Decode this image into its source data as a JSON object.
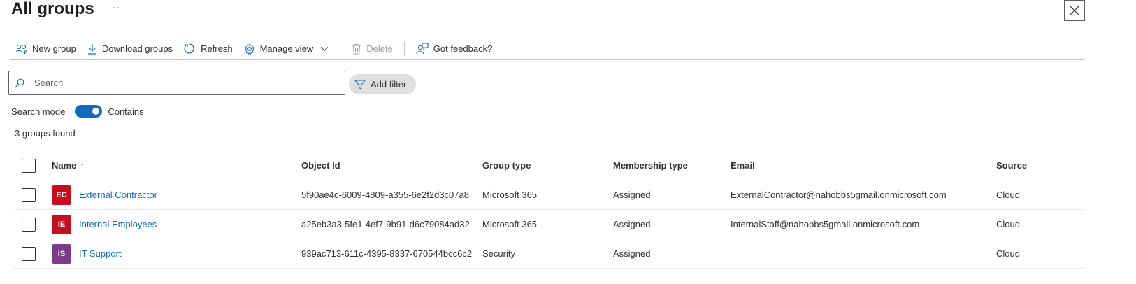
{
  "page": {
    "title": "All groups",
    "more_label": "···"
  },
  "toolbar": {
    "new_group": "New group",
    "download_groups": "Download groups",
    "refresh": "Refresh",
    "manage_view": "Manage view",
    "delete": "Delete",
    "feedback": "Got feedback?"
  },
  "search": {
    "placeholder": "Search",
    "value": ""
  },
  "filter": {
    "add_filter": "Add filter"
  },
  "search_mode": {
    "label": "Search mode",
    "value": "Contains",
    "enabled": true
  },
  "results": {
    "count_text": "3 groups found"
  },
  "table": {
    "columns": {
      "name": "Name",
      "sort_indicator": "↑",
      "object_id": "Object Id",
      "group_type": "Group type",
      "membership_type": "Membership type",
      "email": "Email",
      "source": "Source"
    },
    "rows": [
      {
        "initials": "EC",
        "avatar_color": "#c50f1f",
        "name": "External Contractor",
        "object_id": "5f90ae4c-6009-4809-a355-6e2f2d3c07a8",
        "group_type": "Microsoft 365",
        "membership_type": "Assigned",
        "email": "ExternalContractor@nahobbs5gmail.onmicrosoft.com",
        "source": "Cloud"
      },
      {
        "initials": "IE",
        "avatar_color": "#c50f1f",
        "name": "Internal Employees",
        "object_id": "a25eb3a3-5fe1-4ef7-9b91-d6c79084ad32",
        "group_type": "Microsoft 365",
        "membership_type": "Assigned",
        "email": "InternalStaff@nahobbs5gmail.onmicrosoft.com",
        "source": "Cloud"
      },
      {
        "initials": "IS",
        "avatar_color": "#7a3b8a",
        "name": "IT Support",
        "object_id": "939ac713-611c-4395-8337-670544bcc6c2",
        "group_type": "Security",
        "membership_type": "Assigned",
        "email": "",
        "source": "Cloud"
      }
    ]
  },
  "colors": {
    "accent": "#0f6cbd",
    "link": "#0f6cbd"
  },
  "icons": {
    "new_group": "people-add-icon",
    "download": "download-icon",
    "refresh": "refresh-icon",
    "manage_view": "gear-icon",
    "delete": "trash-icon",
    "feedback": "person-feedback-icon",
    "search": "search-icon",
    "filter": "filter-icon",
    "close": "close-icon"
  }
}
